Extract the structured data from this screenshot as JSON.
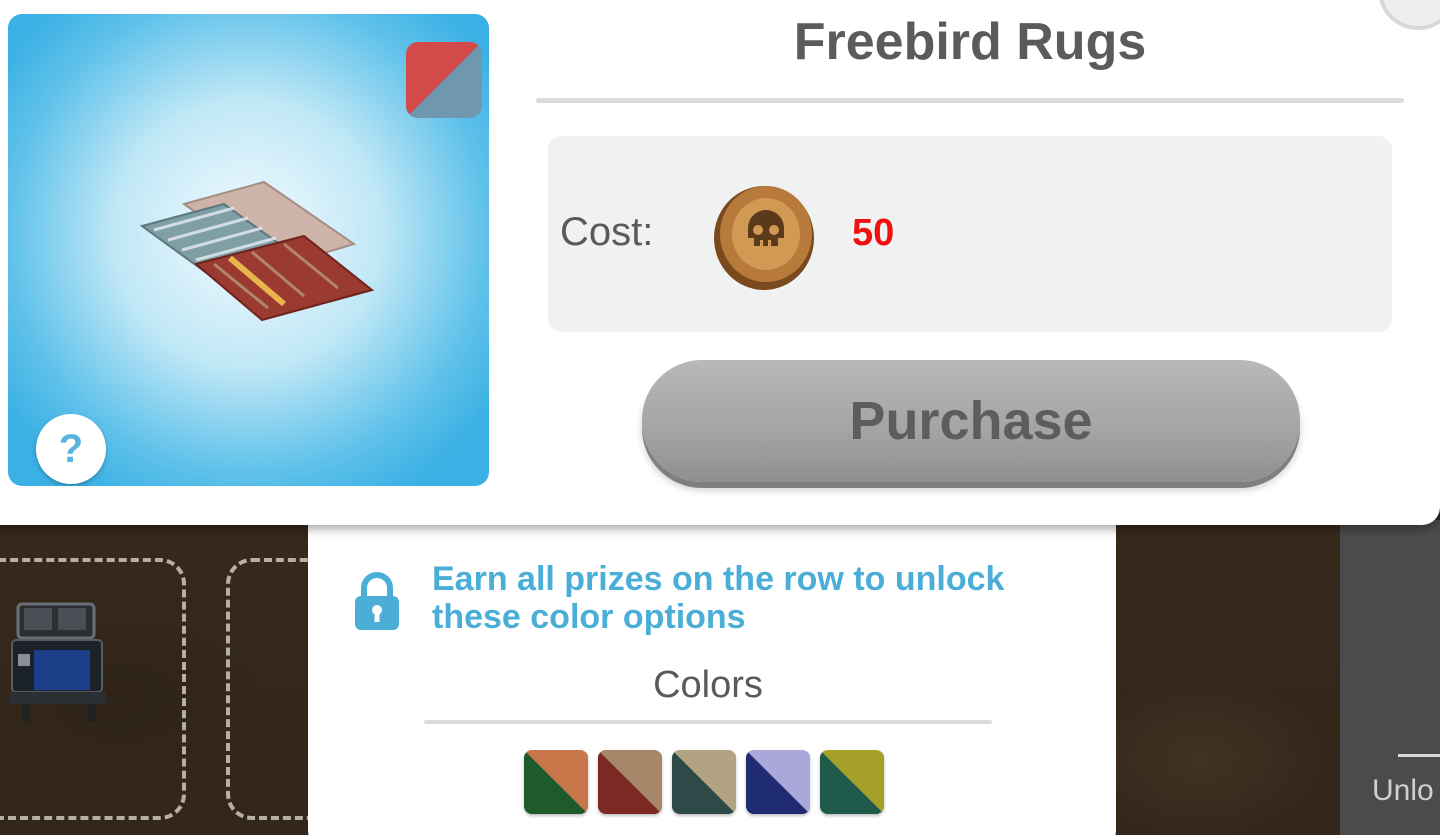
{
  "dialog": {
    "title": "Freebird Rugs",
    "cost_label": "Cost:",
    "cost_value": "50",
    "cost_currency_icon": "skull-coin-icon",
    "purchase_label": "Purchase",
    "help_label": "?",
    "color_badge_colors": [
      "#d34a4a",
      "#6f97b0"
    ]
  },
  "colors_panel": {
    "lock_message": "Earn all prizes on the row to unlock these color options",
    "title": "Colors",
    "swatches": [
      {
        "primary": "#1e5a2a",
        "secondary": "#c8774a"
      },
      {
        "primary": "#7a2a22",
        "secondary": "#a7876a"
      },
      {
        "primary": "#2e4a48",
        "secondary": "#b2a482"
      },
      {
        "primary": "#1f2c72",
        "secondary": "#aaa8d8"
      },
      {
        "primary": "#1f5a4a",
        "secondary": "#a4a028"
      }
    ]
  },
  "background": {
    "right_panel_text": "Unlo"
  },
  "colors": {
    "accent_blue": "#4aaed7",
    "cost_red": "#f01010",
    "button_gray": "#a3a3a3"
  }
}
